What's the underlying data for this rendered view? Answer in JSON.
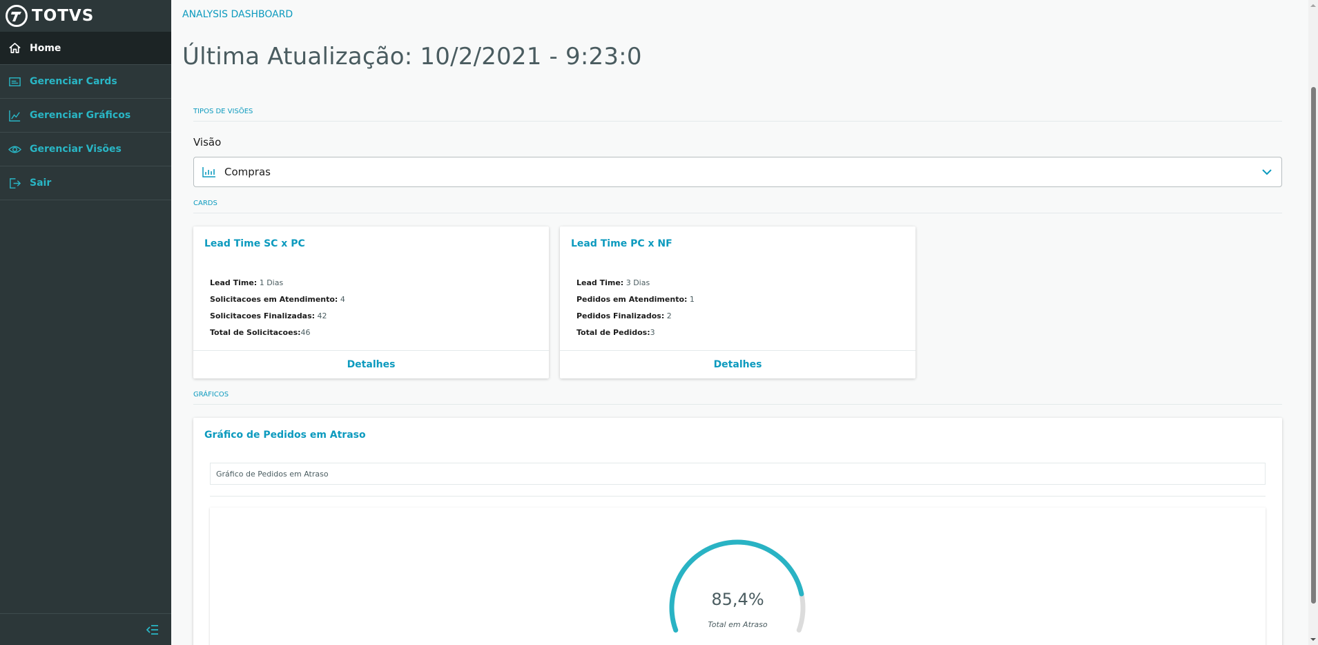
{
  "brand": {
    "name": "TOTVS"
  },
  "sidebar": {
    "items": [
      {
        "label": "Home",
        "icon": "home-icon",
        "active": true
      },
      {
        "label": "Gerenciar Cards",
        "icon": "card-icon",
        "active": false
      },
      {
        "label": "Gerenciar Gráficos",
        "icon": "chart-icon",
        "active": false
      },
      {
        "label": "Gerenciar Visões",
        "icon": "eye-icon",
        "active": false
      },
      {
        "label": "Sair",
        "icon": "exit-icon",
        "active": false
      }
    ],
    "collapse_icon": "collapse-menu-icon"
  },
  "header": {
    "breadcrumb": "ANALYSIS DASHBOARD",
    "title": "Última Atualização: 10/2/2021 - 9:23:0"
  },
  "views": {
    "section_title": "TIPOS DE VISÕES",
    "field_label": "Visão",
    "selected": "Compras",
    "icon": "bar-chart-icon"
  },
  "cards": {
    "section_title": "CARDS",
    "items": [
      {
        "title": "Lead Time SC x PC",
        "lines": [
          {
            "label": "Lead Time:",
            "value": " 1 Dias"
          },
          {
            "label": "Solicitacoes em Atendimento:",
            "value": " 4"
          },
          {
            "label": "Solicitacoes Finalizadas:",
            "value": " 42"
          },
          {
            "label": "Total de Solicitacoes:",
            "value": "46"
          }
        ],
        "action": "Detalhes"
      },
      {
        "title": "Lead Time PC x NF",
        "lines": [
          {
            "label": "Lead Time:",
            "value": " 3 Dias"
          },
          {
            "label": "Pedidos em Atendimento:",
            "value": " 1"
          },
          {
            "label": "Pedidos Finalizados:",
            "value": " 2"
          },
          {
            "label": "Total de Pedidos:",
            "value": "3"
          }
        ],
        "action": "Detalhes"
      }
    ]
  },
  "charts": {
    "section_title": "GRÁFICOS",
    "panel_title": "Gráfico de Pedidos em Atraso",
    "header_label": "Gráfico de Pedidos em Atraso",
    "gauge_value_text": "85,4%",
    "gauge_label": "Total em Atraso"
  },
  "chart_data": {
    "type": "gauge",
    "value": 85.4,
    "max": 100,
    "title": "",
    "label": "Total em Atraso",
    "colors": {
      "fill": "#29b3c4",
      "track": "#dcdcdc"
    }
  },
  "colors": {
    "sidebar_bg": "#2c3739",
    "sidebar_active": "#1c2425",
    "accent": "#0c9abe",
    "menu_text": "#29b6c5"
  }
}
